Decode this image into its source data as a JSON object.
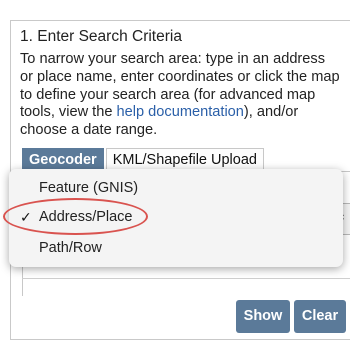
{
  "section": {
    "title": "1. Enter Search Criteria",
    "instructions": {
      "line1": "To narrow your search area: type in an address",
      "line2": "or place name, enter coordinates or click the map",
      "line3": "to define your search area (for advanced map",
      "line4_before": "tools, view the ",
      "line4_link": "help documentation",
      "line4_after": "), and/or",
      "line5": "choose a date range."
    }
  },
  "tabs": [
    {
      "label": "Geocoder",
      "active": true
    },
    {
      "label": "KML/Shapefile Upload",
      "active": false
    }
  ],
  "dropdown": {
    "options": [
      {
        "label": "Feature (GNIS)",
        "selected": false
      },
      {
        "label": "Address/Place",
        "selected": true
      },
      {
        "label": "Path/Row",
        "selected": false
      }
    ],
    "check_glyph": "✓"
  },
  "buttons": {
    "show": "Show",
    "clear": "Clear"
  },
  "icons": {
    "select_arrows": "updown-arrows-icon"
  },
  "colors": {
    "accent": "#5b7a99",
    "link": "#2a5fa8",
    "highlight": "#d9534f"
  }
}
